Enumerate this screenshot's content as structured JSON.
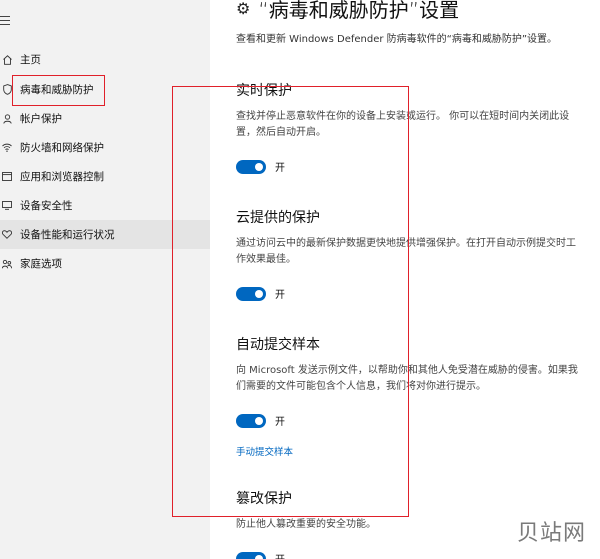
{
  "sidebar": {
    "items": [
      {
        "label": "主页",
        "icon": "home-icon"
      },
      {
        "label": "病毒和威胁防护",
        "icon": "shield-icon"
      },
      {
        "label": "帐户保护",
        "icon": "person-icon"
      },
      {
        "label": "防火墙和网络保护",
        "icon": "wifi-icon"
      },
      {
        "label": "应用和浏览器控制",
        "icon": "browser-icon"
      },
      {
        "label": "设备安全性",
        "icon": "device-icon"
      },
      {
        "label": "设备性能和运行状况",
        "icon": "heart-icon"
      },
      {
        "label": "家庭选项",
        "icon": "family-icon"
      }
    ]
  },
  "header": {
    "title": "“病毒和威胁防护”设置",
    "subtitle": "查看和更新 Windows Defender 防病毒软件的“病毒和威胁防护”设置。"
  },
  "sections": [
    {
      "title": "实时保护",
      "desc": "查找并停止恶意软件在你的设备上安装或运行。 你可以在短时间内关闭此设置，然后自动开启。",
      "toggle": "开",
      "state": "on"
    },
    {
      "title": "云提供的保护",
      "desc": "通过访问云中的最新保护数据更快地提供增强保护。在打开自动示例提交时工作效果最佳。",
      "toggle": "开",
      "state": "on"
    },
    {
      "title": "自动提交样本",
      "desc": "向 Microsoft 发送示例文件，以帮助你和其他人免受潜在威胁的侵害。如果我们需要的文件可能包含个人信息，我们将对你进行提示。",
      "toggle": "开",
      "state": "on",
      "link": "手动提交样本"
    },
    {
      "title": "篡改保护",
      "desc": "防止他人篡改重要的安全功能。",
      "toggle": "开",
      "state": "on"
    }
  ],
  "watermark": "贝站网",
  "colors": {
    "accent": "#0067c0",
    "highlight": "#e0202a"
  }
}
